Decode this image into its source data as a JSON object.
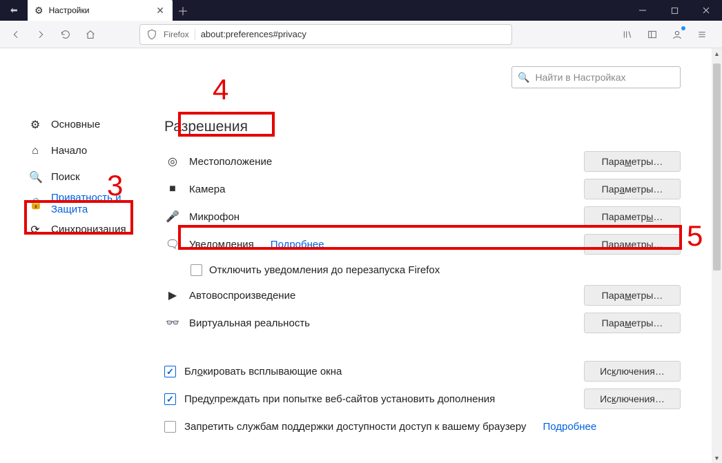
{
  "window": {
    "tab_title": "Настройки",
    "new_tab_tooltip": "+"
  },
  "toolbar": {
    "identity_label": "Firefox",
    "url": "about:preferences#privacy"
  },
  "search": {
    "placeholder": "Найти в Настройках"
  },
  "sidebar": {
    "items": [
      {
        "label": "Основные"
      },
      {
        "label": "Начало"
      },
      {
        "label": "Поиск"
      },
      {
        "label": "Приватность и Защита"
      },
      {
        "label": "Синхронизация"
      }
    ]
  },
  "permissions": {
    "title": "Разрешения",
    "rows": [
      {
        "label": "Местоположение",
        "button": "Параметры…",
        "accesskey": "м"
      },
      {
        "label": "Камера",
        "button": "Параметры…",
        "accesskey": "а"
      },
      {
        "label": "Микрофон",
        "button": "Параметры…",
        "accesskey": "ы"
      },
      {
        "label": "Уведомления",
        "link": "Подробнее",
        "button": "Параметры…",
        "accesskey": "е"
      },
      {
        "label": "Автовоспроизведение",
        "button": "Параметры…",
        "accesskey": "м"
      },
      {
        "label": "Виртуальная реальность",
        "button": "Параметры…",
        "accesskey": "м"
      }
    ],
    "pause_notifications_label": "Отключить уведомления до перезапуска Firefox",
    "block_popups": {
      "label": "Блокировать всплывающие окна",
      "button": "Исключения…",
      "checked": true
    },
    "warn_addons": {
      "label": "Предупреждать при попытке веб-сайтов установить дополнения",
      "button": "Исключения…",
      "checked": true
    },
    "block_a11y": {
      "label": "Запретить службам поддержки доступности доступ к вашему браузеру",
      "link": "Подробнее",
      "checked": false
    }
  },
  "annotations": {
    "n3": "3",
    "n4": "4",
    "n5": "5"
  }
}
